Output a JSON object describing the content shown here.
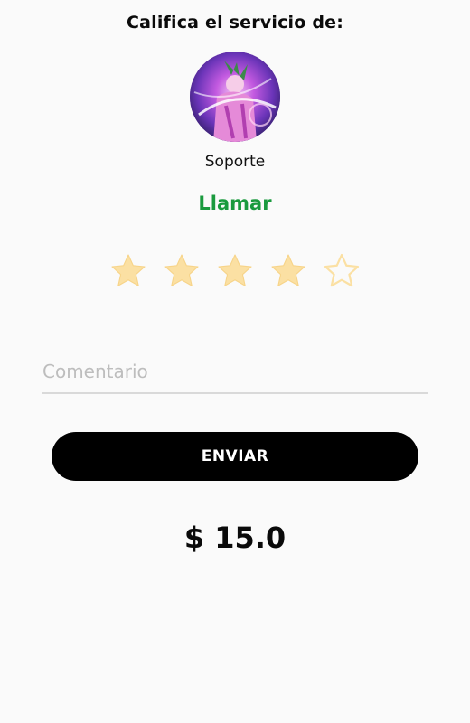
{
  "header": {
    "title": "Califica el servicio de:"
  },
  "agent": {
    "avatar_icon": "anime-character-avatar",
    "name": "Soporte"
  },
  "call_action": {
    "label": "Llamar",
    "color": "#1a9a3e"
  },
  "rating": {
    "value": 4,
    "max": 5,
    "star_color": "#fbe0a3"
  },
  "comment": {
    "value": "",
    "placeholder": "Comentario"
  },
  "submit": {
    "label": "ENVIAR"
  },
  "price": {
    "label": "$ 15.0"
  }
}
